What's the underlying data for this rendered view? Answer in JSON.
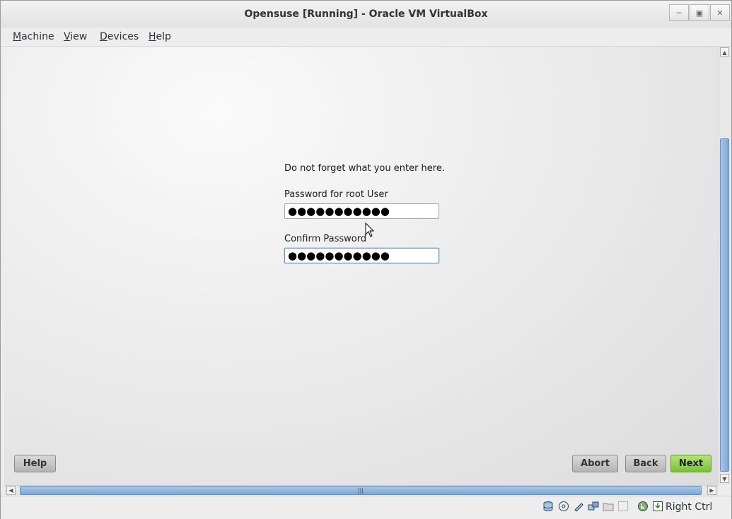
{
  "window": {
    "title": "Opensuse [Running] - Oracle VM VirtualBox"
  },
  "menu": [
    {
      "label": "Machine",
      "mnemonic": "M",
      "rest": "achine"
    },
    {
      "label": "View",
      "mnemonic": "V",
      "rest": "iew"
    },
    {
      "label": "Devices",
      "mnemonic": "D",
      "rest": "evices"
    },
    {
      "label": "Help",
      "mnemonic": "H",
      "rest": "elp"
    }
  ],
  "installer": {
    "note": "Do not forget what you enter here.",
    "password_label": "Password for root User",
    "password_value": "●●●●●●●●●●●",
    "confirm_label": "Confirm Password",
    "confirm_value": "●●●●●●●●●●●"
  },
  "buttons": {
    "help": "Help",
    "abort": "Abort",
    "back": "Back",
    "next": "Next"
  },
  "statusbar": {
    "host_key": "Right Ctrl",
    "icons": [
      "hard-disk-icon",
      "optical-drive-icon",
      "usb-icon",
      "network-icon",
      "shared-folder-icon",
      "display-icon",
      "mouse-integration-icon",
      "download-icon"
    ]
  },
  "colors": {
    "next_button": "#79c13a",
    "scroll_thumb": "#7ea7d6"
  }
}
